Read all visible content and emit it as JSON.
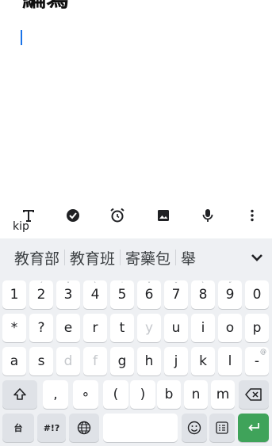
{
  "editor": {
    "title_text": "編寫",
    "content": ""
  },
  "toolbar": {
    "items": [
      {
        "name": "text-format-icon"
      },
      {
        "name": "check-circle-icon"
      },
      {
        "name": "alarm-icon"
      },
      {
        "name": "image-icon"
      },
      {
        "name": "microphone-icon"
      },
      {
        "name": "more-vert-icon"
      }
    ],
    "skip_label": "kip"
  },
  "keyboard": {
    "candidates": [
      "教育部",
      "教育班",
      "寄藥包",
      "舉"
    ],
    "expand_icon": "chevron-down-icon",
    "row1": [
      {
        "label": "1",
        "hint": ""
      },
      {
        "label": "2",
        "hint": "ˊ"
      },
      {
        "label": "3",
        "hint": "ˇ"
      },
      {
        "label": "4",
        "hint": "ˋ"
      },
      {
        "label": "5",
        "hint": "˙"
      },
      {
        "label": "6",
        "hint": "ˇ"
      },
      {
        "label": "7",
        "hint": "˘"
      },
      {
        "label": "8",
        "hint": "ˋ"
      },
      {
        "label": "9",
        "hint": "˝"
      },
      {
        "label": "0",
        "hint": ""
      }
    ],
    "row2": [
      "*",
      "?",
      "e",
      "r",
      "t",
      "y",
      "u",
      "i",
      "o",
      "p"
    ],
    "row3": [
      "a",
      "s",
      "d",
      "f",
      "g",
      "h",
      "j",
      "k",
      "l",
      "-"
    ],
    "row3_hint_last": "@",
    "row4": [
      ",",
      "∘",
      "(",
      ")",
      "b",
      "n",
      "m"
    ],
    "row5": {
      "lang": "台",
      "symbols": "#!?",
      "emoji_icon": "smiley-icon",
      "clipboard_icon": "keyboard-layout-icon",
      "enter_icon": "enter-icon",
      "globe_icon": "globe-icon"
    },
    "colors": {
      "accent": "#1a73e8",
      "enter": "#3fa35a",
      "bg": "#eef0f3"
    }
  }
}
